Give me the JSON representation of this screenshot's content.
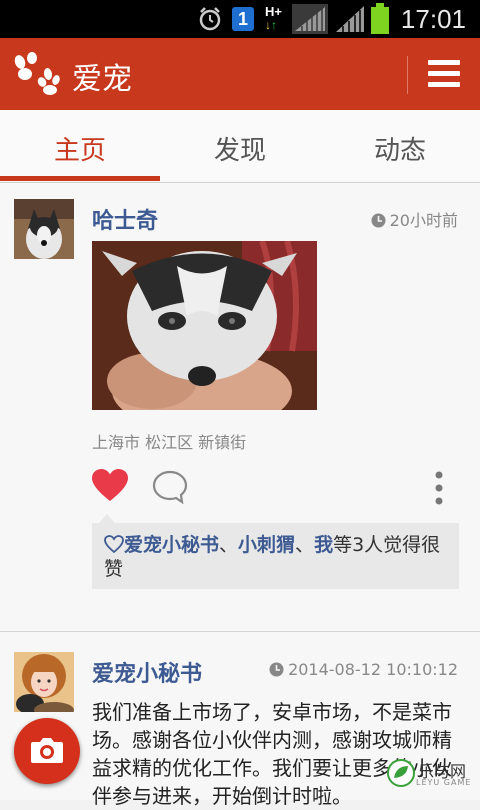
{
  "status_bar": {
    "time": "17:01",
    "icons": [
      "alarm-icon",
      "notification-badge-icon",
      "data-hplus-icon",
      "signal-icon",
      "signal-icon",
      "battery-icon"
    ],
    "badge_number": "1",
    "network_label": "H+"
  },
  "app_bar": {
    "title": "爱宠",
    "logo_icon": "paw-icon",
    "menu_icon": "hamburger-menu-icon",
    "background": "#c8381c"
  },
  "tabs": [
    {
      "label": "主页",
      "active": true
    },
    {
      "label": "发现",
      "active": false
    },
    {
      "label": "动态",
      "active": false
    }
  ],
  "posts": [
    {
      "username": "哈士奇",
      "time": "20小时前",
      "location": "上海市 松江区 新镇街",
      "likes": {
        "names": [
          "爱宠小秘书",
          "小刺猬",
          "我"
        ],
        "separator": "、",
        "suffix": "等3人觉得很赞"
      }
    },
    {
      "username": "爱宠小秘书",
      "time": "2014-08-12 10:10:12",
      "text": "我们准备上市场了，安卓市场，不是菜市场。感谢各位小伙伴内测，感谢攻城师精益求精的优化工作。我们要让更多的小伙伴参与进来，开始倒计时啦。"
    }
  ],
  "fab": {
    "icon": "camera-icon"
  },
  "watermark": {
    "text": "乐与网",
    "sub": "LEYU GAME"
  },
  "colors": {
    "accent": "#c8381c",
    "link": "#3d5a92",
    "like": "#e83a48"
  }
}
